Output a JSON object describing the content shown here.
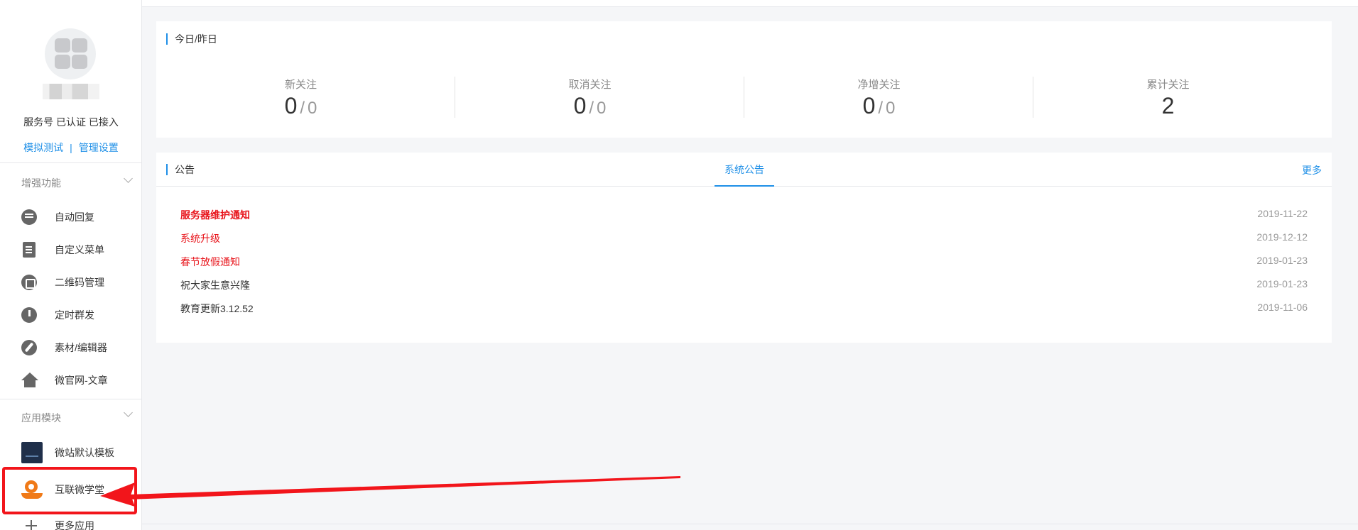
{
  "account": {
    "status": "服务号 已认证 已接入",
    "link_test": "模拟测试",
    "link_sep": "|",
    "link_settings": "管理设置"
  },
  "sections": {
    "enhanced": "增强功能",
    "modules": "应用模块"
  },
  "enhanced_items": [
    {
      "label": "自动回复",
      "icon": "chat-bubble-icon"
    },
    {
      "label": "自定义菜单",
      "icon": "document-edit-icon"
    },
    {
      "label": "二维码管理",
      "icon": "qrcode-icon"
    },
    {
      "label": "定时群发",
      "icon": "clock-icon"
    },
    {
      "label": "素材/编辑器",
      "icon": "pencil-icon"
    },
    {
      "label": "微官网-文章",
      "icon": "home-icon"
    }
  ],
  "module_items": [
    {
      "label": "微站默认模板",
      "icon": "template-thumbnail-icon"
    },
    {
      "label": "互联微学堂",
      "icon": "edu-app-icon"
    },
    {
      "label": "更多应用",
      "icon": "plus-icon"
    }
  ],
  "stats_card": {
    "title": "今日/昨日",
    "items": [
      {
        "label": "新关注",
        "today": "0",
        "sep": "/",
        "yesterday": "0"
      },
      {
        "label": "取消关注",
        "today": "0",
        "sep": "/",
        "yesterday": "0"
      },
      {
        "label": "净增关注",
        "today": "0",
        "sep": "/",
        "yesterday": "0"
      },
      {
        "label": "累计关注",
        "today": "2"
      }
    ]
  },
  "notice_card": {
    "title": "公告",
    "tab": "系统公告",
    "more": "更多",
    "items": [
      {
        "title": "服务器维护通知",
        "date": "2019-11-22",
        "color": "#e8141b",
        "bold": true
      },
      {
        "title": "系统升级",
        "date": "2019-12-12",
        "color": "#e8141b",
        "bold": false
      },
      {
        "title": "春节放假通知",
        "date": "2019-01-23",
        "color": "#e8141b",
        "bold": false
      },
      {
        "title": "祝大家生意兴隆",
        "date": "2019-01-23",
        "color": "#333333",
        "bold": false
      },
      {
        "title": "教育更新3.12.52",
        "date": "2019-11-06",
        "color": "#333333",
        "bold": false
      }
    ]
  },
  "colors": {
    "accent": "#1e8fe7",
    "alert_red": "#e8141b",
    "annotation_red": "#f2151b"
  }
}
